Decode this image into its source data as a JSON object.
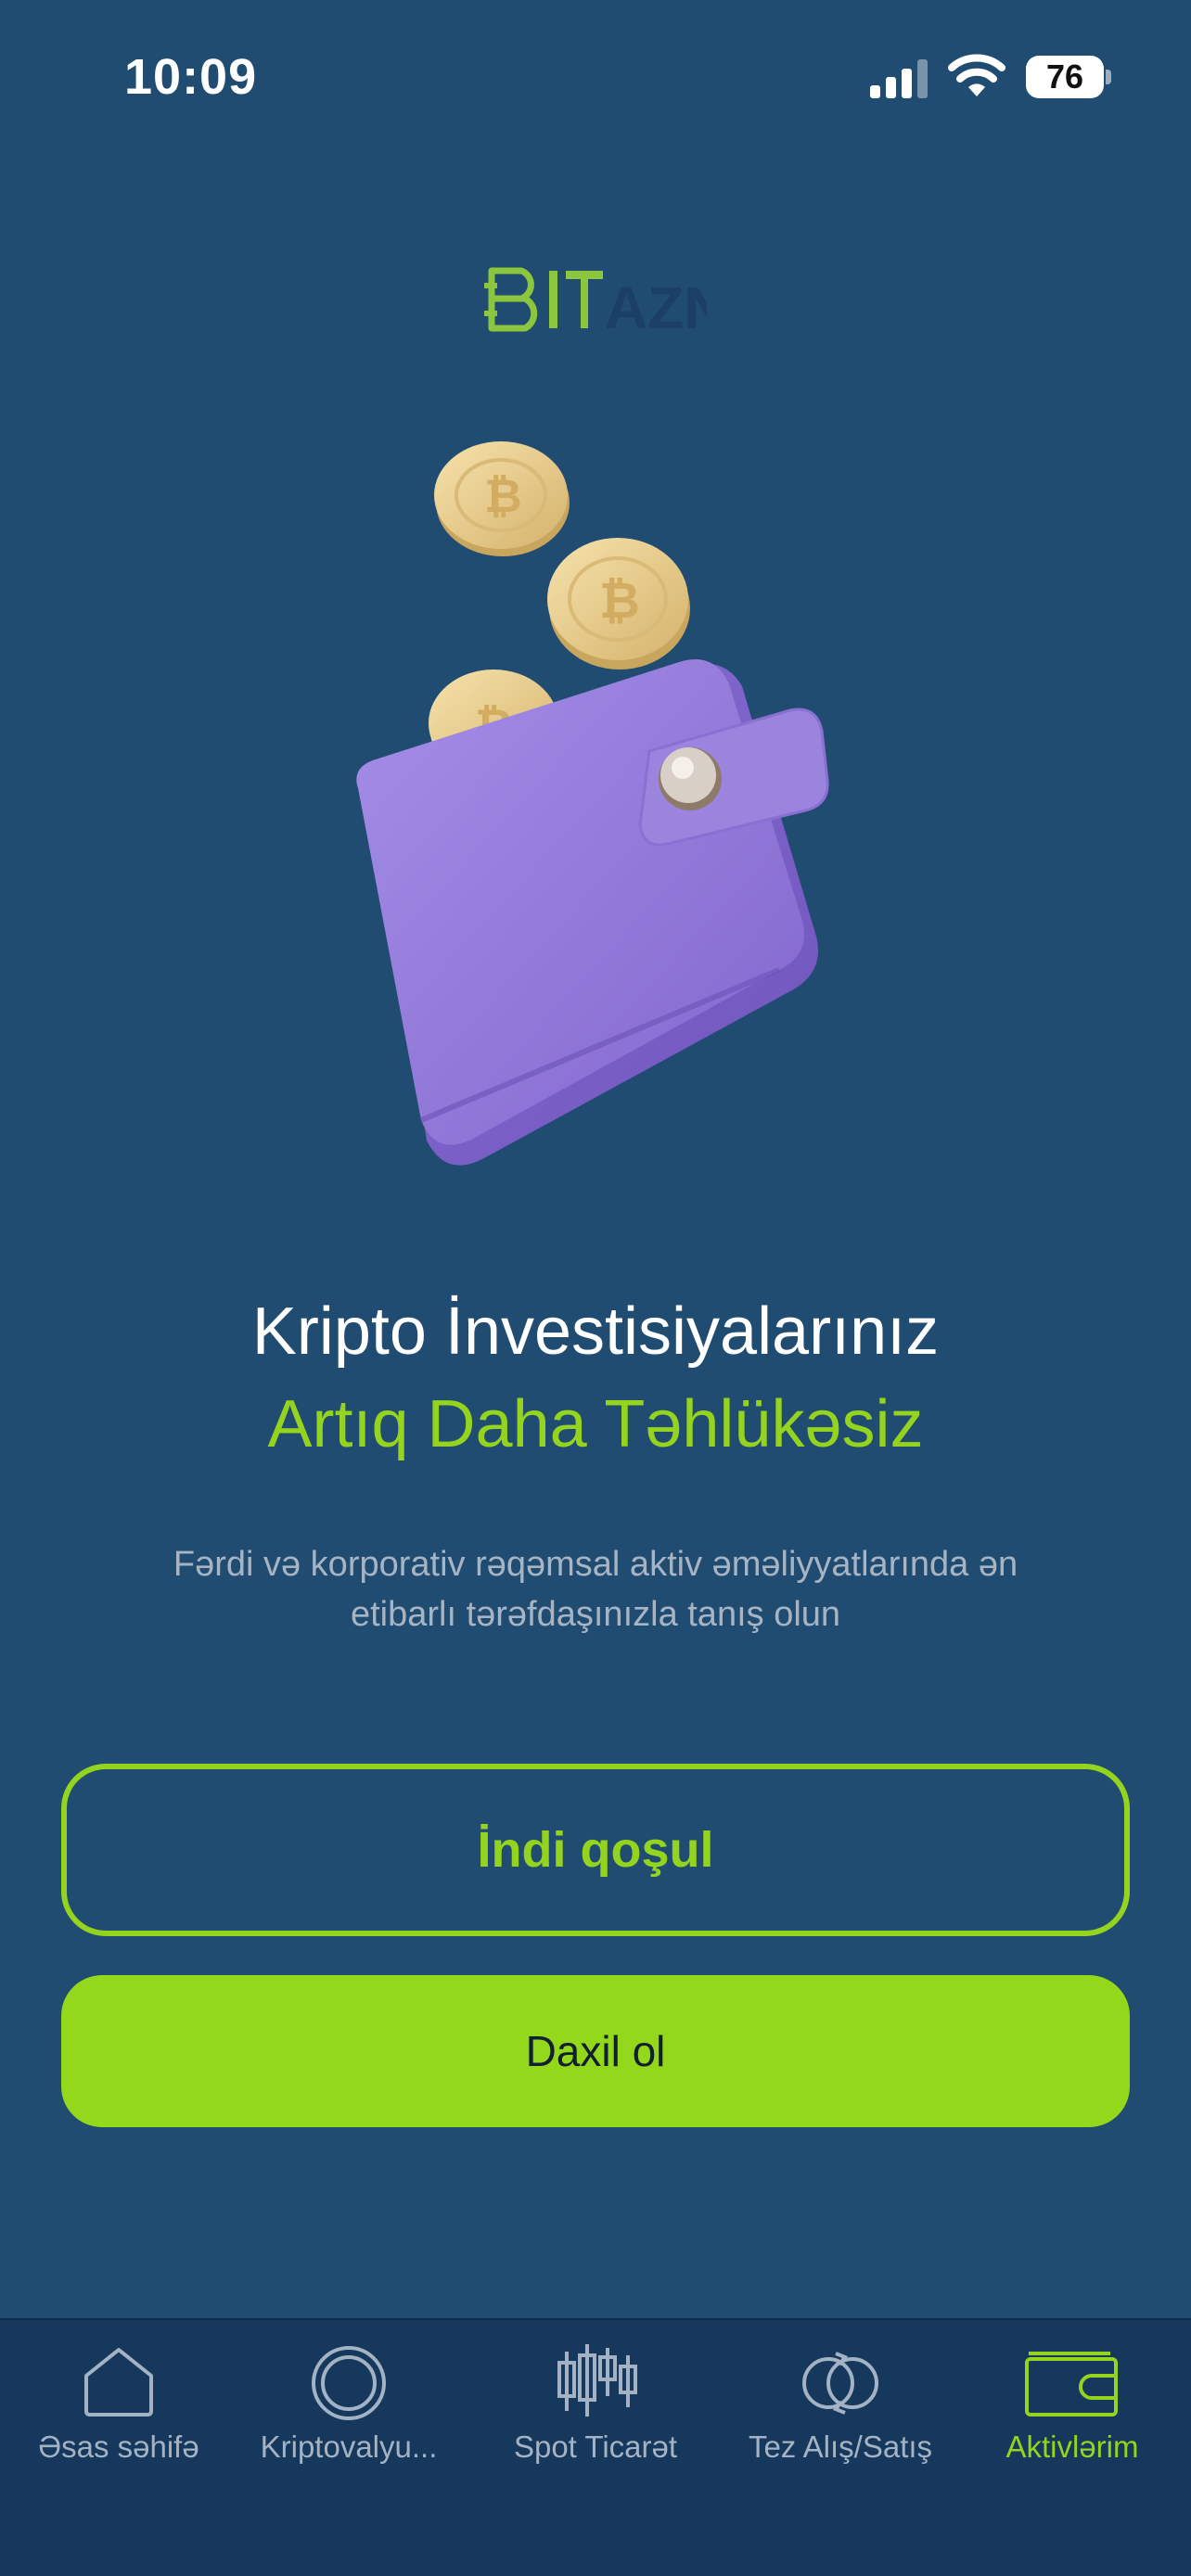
{
  "status_bar": {
    "time": "10:09",
    "battery": "76"
  },
  "logo": {
    "part1": "BIT",
    "part2": "AZN",
    "color_primary": "#8cc63f",
    "color_secondary": "#1b3f66"
  },
  "hero": {
    "title_line1": "Kripto İnvestisiyalarınız",
    "title_line2": "Artıq Daha Təhlükəsiz",
    "subtitle_line1": "Fərdi və korporativ rəqəmsal aktiv əməliyyatlarında ən",
    "subtitle_line2": "etibarlı tərəfdaşınızla tanış olun"
  },
  "buttons": {
    "join": "İndi qoşul",
    "login": "Daxil ol"
  },
  "tab_bar": {
    "items": [
      {
        "label": "Əsas səhifə",
        "icon": "home-icon",
        "active": false
      },
      {
        "label": "Kriptovalyu...",
        "icon": "coin-icon",
        "active": false
      },
      {
        "label": "Spot Ticarət",
        "icon": "candlestick-icon",
        "active": false
      },
      {
        "label": "Tez Alış/Satış",
        "icon": "exchange-icon",
        "active": false
      },
      {
        "label": "Aktivlərim",
        "icon": "wallet-icon",
        "active": true
      }
    ]
  },
  "colors": {
    "background": "#204c72",
    "accent": "#94d41f",
    "tab_bar": "#15385c",
    "wallet": "#9a84de"
  }
}
